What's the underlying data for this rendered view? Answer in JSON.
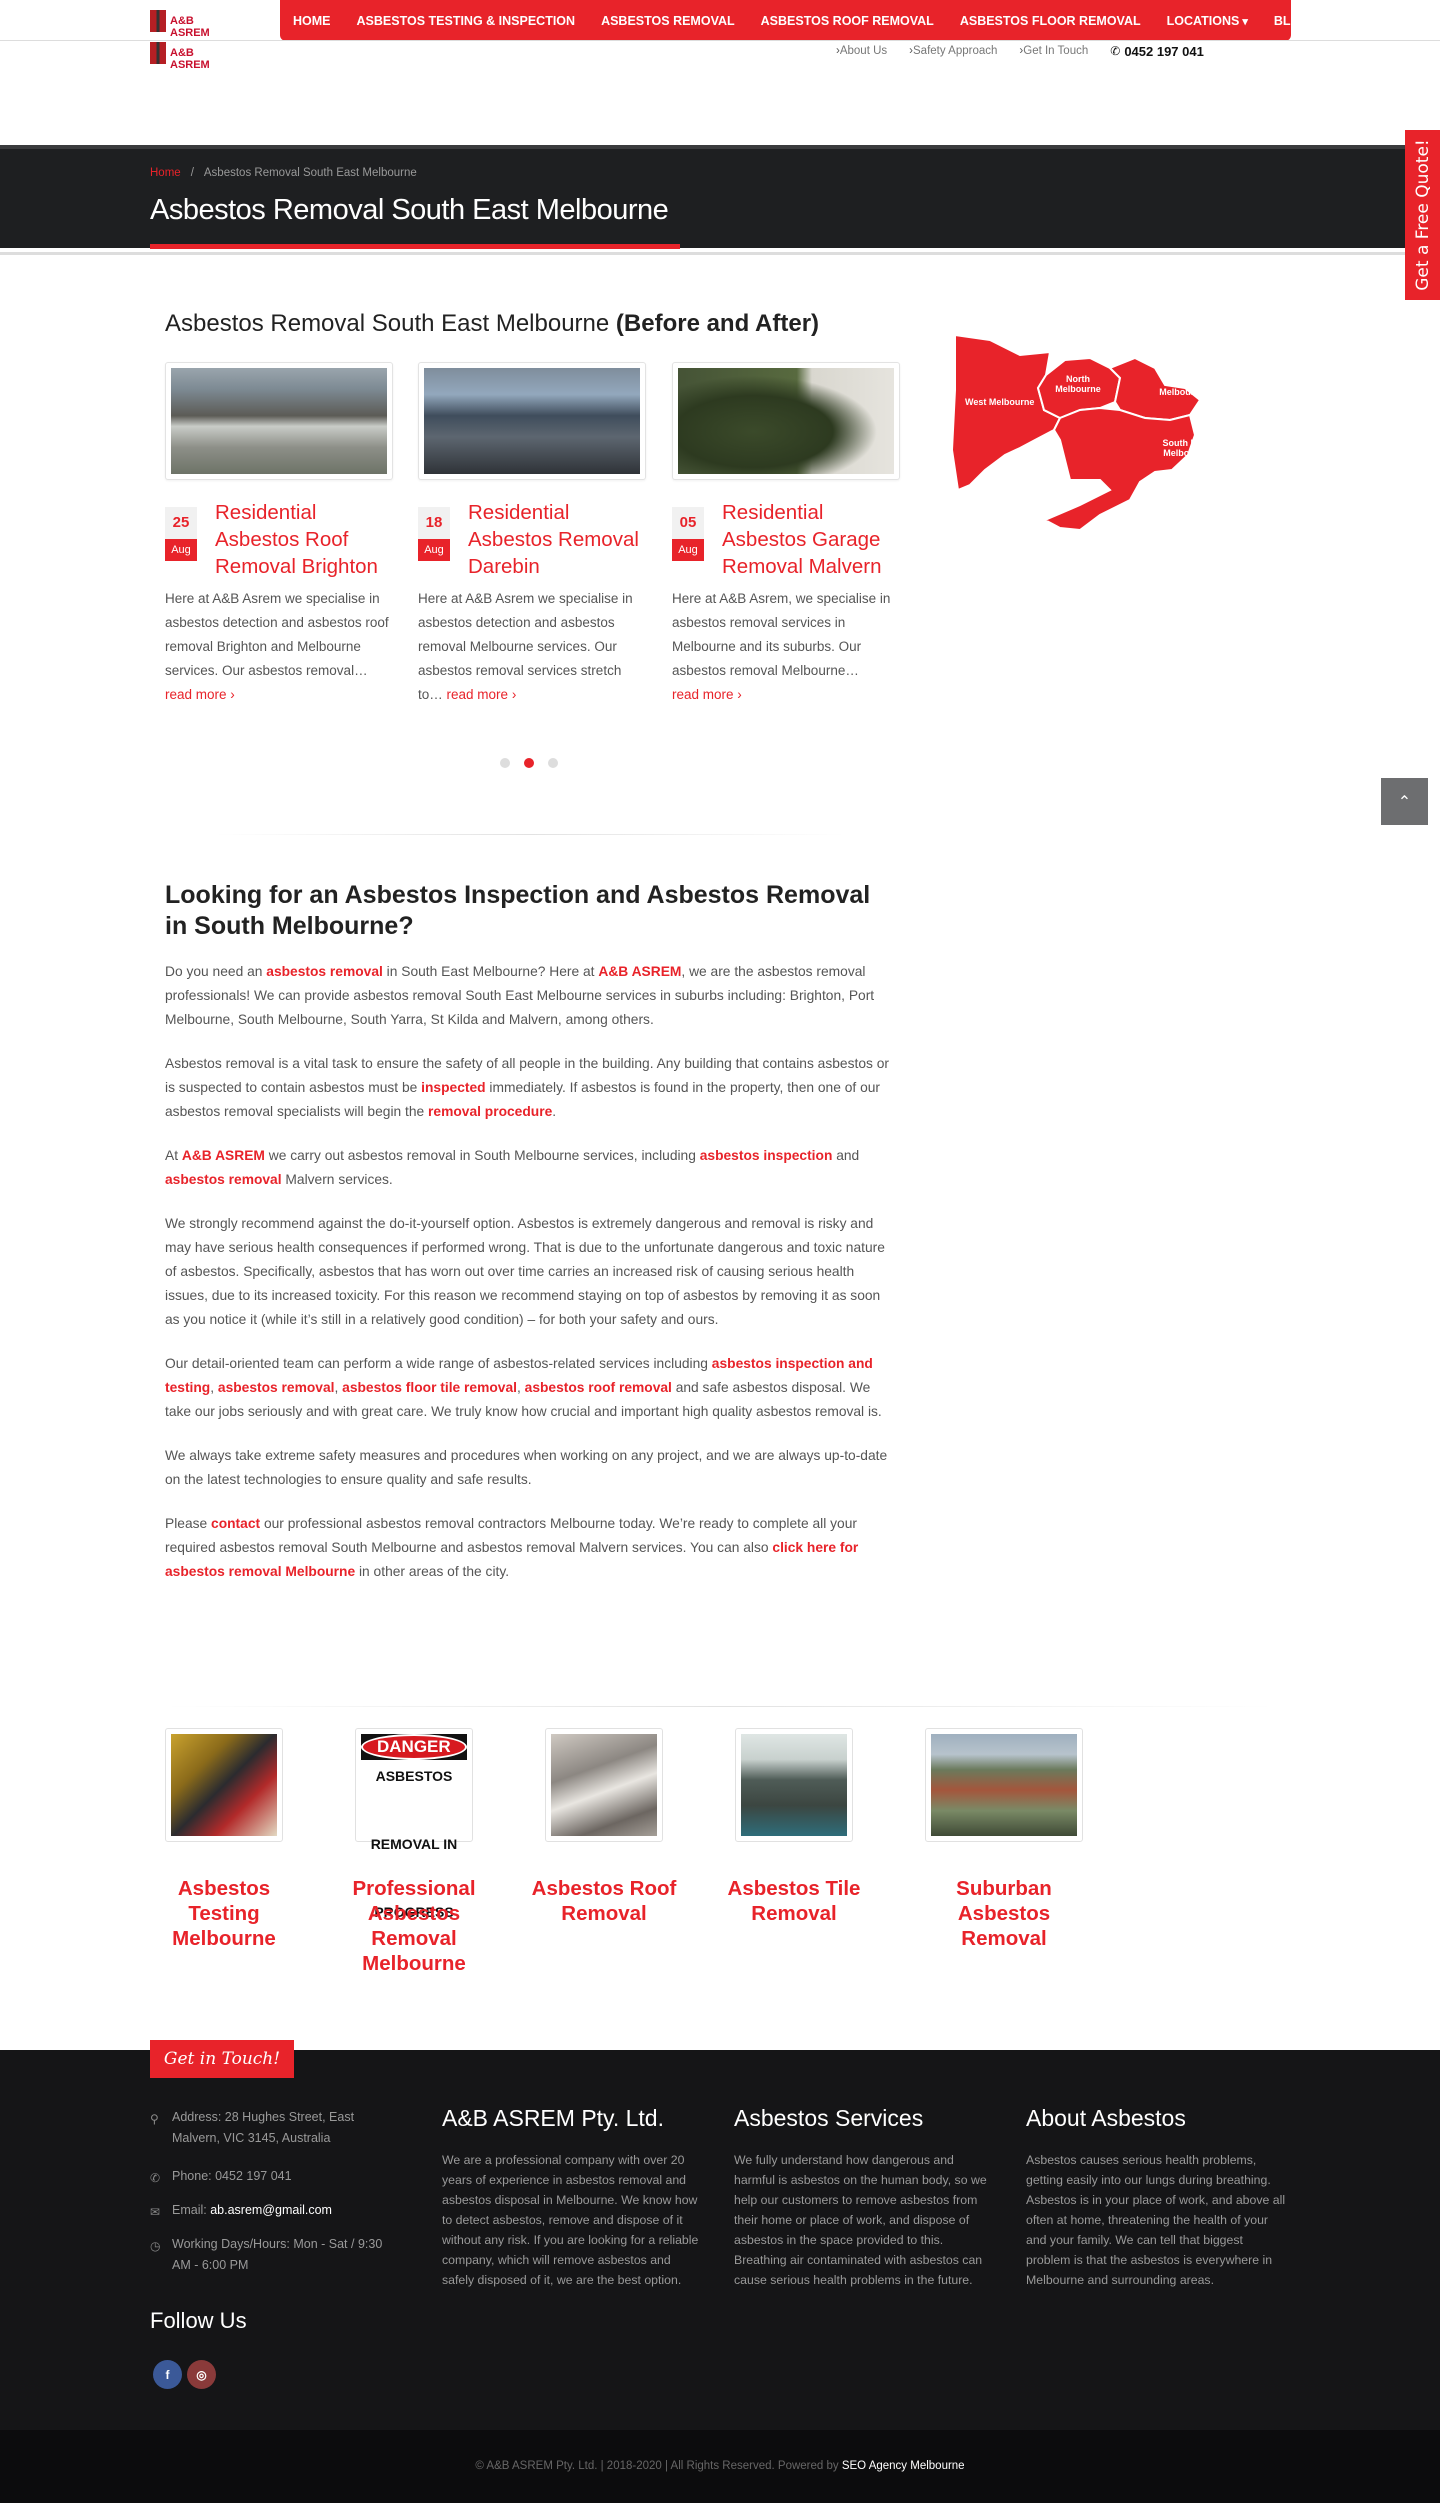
{
  "brand": {
    "name": "A&B ASREM"
  },
  "nav": {
    "items": [
      "HOME",
      "ASBESTOS TESTING & INSPECTION",
      "ASBESTOS REMOVAL",
      "ASBESTOS ROOF REMOVAL",
      "ASBESTOS FLOOR REMOVAL",
      "LOCATIONS",
      "BLOG"
    ]
  },
  "toplinks": {
    "about": "About Us",
    "safety": "Safety Approach",
    "touch": "Get In Touch",
    "phone": "0452 197 041"
  },
  "breadcrumb": {
    "home": "Home",
    "sep": "/",
    "current": "Asbestos Removal South East Melbourne"
  },
  "page_title": "Asbestos Removal South East Melbourne",
  "quote_tab": "Get a Free Quote!",
  "gallery": {
    "heading_plain": "Asbestos Removal South East Melbourne",
    "heading_bold": "(Before and After)",
    "cards": [
      {
        "day": "25",
        "month": "Aug",
        "title": "Residential Asbestos Roof Removal Brighton",
        "excerpt": "Here at A&B Asrem we specialise in asbestos detection and asbestos roof removal Brighton and Melbourne services. Our asbestos removal…",
        "more": "read more"
      },
      {
        "day": "18",
        "month": "Aug",
        "title": "Residential Asbestos Removal Darebin",
        "excerpt": "Here at A&B Asrem we specialise in asbestos detection and asbestos removal Melbourne services. Our asbestos removal services stretch to…",
        "more": "read more"
      },
      {
        "day": "05",
        "month": "Aug",
        "title": "Residential Asbestos Garage Removal Malvern",
        "excerpt": "Here at A&B Asrem, we specialise in asbestos removal services in Melbourne and its suburbs. Our asbestos removal Melbourne…",
        "more": "read more"
      }
    ]
  },
  "map": {
    "west": "West Melbourne",
    "north": [
      "North",
      "Melbourne"
    ],
    "east": [
      "East",
      "Melbourne"
    ],
    "southeast": [
      "South East",
      "Melbourne"
    ]
  },
  "intro": {
    "heading": "Looking for an Asbestos Inspection and Asbestos Removal in South Melbourne?",
    "p1": {
      "a": "Do you need an ",
      "l1": "asbestos removal",
      "b": " in South East Melbourne? Here at ",
      "l2": "A&B ASREM",
      "c": ", we are the asbestos removal professionals! We can provide asbestos removal South East Melbourne services in suburbs including: Brighton, Port Melbourne, South Melbourne, South Yarra, St Kilda and Malvern, among others."
    },
    "p2": {
      "a": "Asbestos removal is a vital task to ensure the safety of all people in the building. Any building that contains asbestos or is suspected to contain asbestos must be ",
      "l1": "inspected",
      "b": " immediately. If asbestos is found in the property, then one of our asbestos removal specialists will begin the ",
      "l2": "removal procedure",
      "c": "."
    },
    "p3": {
      "a": "At ",
      "l1": "A&B ASREM",
      "b": " we carry out asbestos removal in South Melbourne services, including ",
      "l2": "asbestos inspection",
      "c": " and ",
      "l3": "asbestos removal",
      "d": " Malvern services."
    },
    "p4": "We strongly recommend against the do-it-yourself option. Asbestos is extremely dangerous and removal is risky and may have serious health consequences if performed wrong. That is due to the unfortunate dangerous and toxic nature of asbestos. Specifically, asbestos that has worn out over time carries an increased risk of causing serious health issues, due to its increased toxicity. For this reason we recommend staying on top of asbestos by removing it as soon as you notice it (while it’s still in a relatively good condition) – for both your safety and ours.",
    "p5": {
      "a": "Our detail-oriented team can perform a wide range of asbestos-related services including ",
      "l1": "asbestos inspection and testing",
      "s1": ", ",
      "l2": "asbestos removal",
      "s2": ", ",
      "l3": "asbestos floor tile removal",
      "s3": ", ",
      "l4": "asbestos roof removal",
      "b": " and safe asbestos disposal. We take our jobs seriously and with great care. We truly know how crucial and important high quality asbestos removal is."
    },
    "p6": "We always take extreme safety measures and procedures when working on any project, and we are always up-to-date on the latest technologies to ensure quality and safe results.",
    "p7": {
      "a": "Please ",
      "l1": "contact",
      "b": " our professional asbestos removal contractors Melbourne today. We’re ready to complete all your required asbestos removal South Melbourne and asbestos removal Malvern services. You can also ",
      "l2": "click here for asbestos removal Melbourne",
      "c": " in other areas of the city."
    }
  },
  "services": [
    {
      "label": "Asbestos Testing Melbourne"
    },
    {
      "label": "Professional Asbestos Removal Melbourne",
      "sign": {
        "top": "DANGER",
        "body": [
          "ASBESTOS",
          "REMOVAL IN",
          "PROGRESS"
        ]
      }
    },
    {
      "label": "Asbestos Roof Removal"
    },
    {
      "label": "Asbestos Tile Removal"
    },
    {
      "label": "Suburban Asbestos Removal"
    }
  ],
  "footer": {
    "badge": "Get in Touch!",
    "address": "Address: 28 Hughes Street, East Malvern, VIC 3145, Australia",
    "phone": "Phone: 0452 197 041",
    "email_label": "Email: ",
    "email": "ab.asrem@gmail.com",
    "hours": "Working Days/Hours: Mon - Sat / 9:30 AM - 6:00 PM",
    "follow": "Follow Us",
    "cols": [
      {
        "title": "A&B ASREM Pty. Ltd.",
        "text": "We are a professional company with over 20 years of experience in asbestos removal and asbestos disposal in Melbourne. We know how to detect asbestos, remove and dispose of it without any risk. If you are looking for a reliable company, which will remove asbestos and safely disposed of it, we are the best option."
      },
      {
        "title": "Asbestos Services",
        "text": "We fully understand how dangerous and harmful is asbestos on the human body, so we help our customers to remove asbestos from their home or place of work, and dispose of asbestos in the space provided to this. Breathing air contaminated with asbestos can cause serious health problems in the future."
      },
      {
        "title": "About Asbestos",
        "text": "Asbestos causes serious health problems, getting easily into our lungs during breathing. Asbestos is in your place of work, and above all often at home, threatening the health of your and your family. We can tell that biggest problem is that the asbestos is everywhere in Melbourne and surrounding areas."
      }
    ],
    "copyright": "© A&B ASREM Pty. Ltd. | 2018-2020 | All Rights Reserved. Powered by ",
    "agency": "SEO Agency Melbourne"
  },
  "colors": {
    "accent": "#e8232a",
    "dark": "#1e1f21",
    "footer": "#151517"
  },
  "icons": [
    "chevron-right-icon",
    "phone-icon",
    "map-pin-icon",
    "envelope-icon",
    "clock-icon",
    "facebook-icon",
    "instagram-icon",
    "chevron-up-icon"
  ]
}
